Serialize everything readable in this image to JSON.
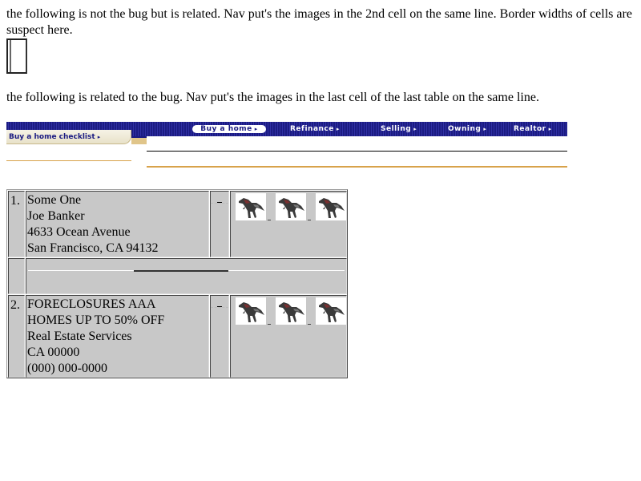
{
  "notes": {
    "p1": "the following is not the bug but is related. Nav put's the images in the 2nd cell on the same line. Border widths of cells are suspect here.",
    "p2": "the following is related to the bug. Nav put's the images in the last cell of the last table on the same line."
  },
  "nav": {
    "buy_a_home": "Buy a home",
    "refinance": "Refinance",
    "selling": "Selling",
    "owning": "Owning",
    "realtor": "Realtor",
    "checklist": "Buy a home checklist",
    "arrow_icon": "▸",
    "colors": {
      "bar": "#1b1b82",
      "accent": "#d8a24a",
      "tab": "#efe9d4"
    }
  },
  "results": [
    {
      "number": "1.",
      "lines": [
        "Some One",
        "Joe Banker",
        "4633 Ocean Avenue",
        "San Francisco,  CA  94132"
      ],
      "images": [
        "dinosaur-icon",
        "dinosaur-icon",
        "dinosaur-icon"
      ]
    },
    {
      "number": "2.",
      "lines": [
        "FORECLOSURES AAA",
        "HOMES UP TO 50% OFF",
        "Real Estate Services",
        "CA  00000",
        "(000) 000-0000"
      ],
      "images": [
        "dinosaur-icon",
        "dinosaur-icon",
        "dinosaur-icon"
      ]
    }
  ]
}
